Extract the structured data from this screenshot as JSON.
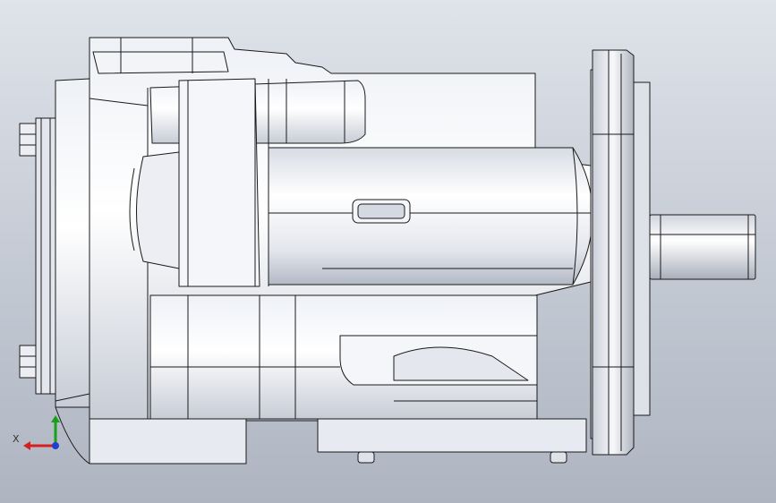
{
  "triad": {
    "x_label": "X"
  },
  "colors": {
    "background_top": "#dfe3ea",
    "background_bottom": "#aeb5c1",
    "body_light": "#fafbfd",
    "body_mid": "#dde1e9",
    "body_dark": "#b9bfca",
    "edge": "#1a1a1a",
    "axis_x": "#d62020",
    "axis_y": "#18a018",
    "axis_z": "#2040d0"
  }
}
